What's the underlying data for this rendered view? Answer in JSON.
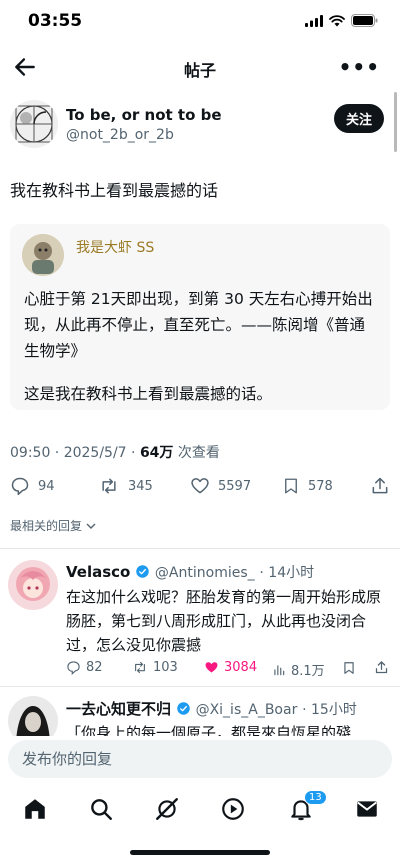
{
  "status_bar": {
    "time": "03:55"
  },
  "nav": {
    "title": "帖子"
  },
  "post": {
    "author_name": "To be, or not to be",
    "author_handle": "@not_2b_or_2b",
    "follow_label": "关注",
    "text": "我在教科书上看到最震撼的话",
    "quote": {
      "name": "我是大虾 SS",
      "body": "心脏于第 21天即出现，到第 30 天左右心搏开始出现，从此再不停止，直至死亡。——陈阅增《普通生物学》",
      "body2": "这是我在教科书上看到最震撼的话。"
    },
    "meta": {
      "time_date": "09:50 · 2025/5/7 · ",
      "views": "64万",
      "views_label": " 次查看"
    },
    "stats": {
      "replies": "94",
      "reposts": "345",
      "likes": "5597",
      "bookmarks": "578"
    }
  },
  "sort_label": "最相关的回复",
  "replies": [
    {
      "name": "Velasco",
      "handle": "@Antinomies_",
      "time": "· 14小时",
      "text": "在这加什么戏呢？胚胎发育的第一周开始形成原肠胚，第七到八周形成肛门，从此再也没闭合过，怎么没见你震撼",
      "replies": "82",
      "reposts": "103",
      "likes": "3084",
      "views": "8.1万"
    },
    {
      "name": "一去心知更不归",
      "handle": "@Xi_is_A_Boar",
      "time": "· 15小时",
      "text": "「你身上的每一個原子，都是來自恆星的殘"
    }
  ],
  "compose": {
    "placeholder": "发布你的回复"
  },
  "tabbar": {
    "notification_count": "13"
  },
  "colors": {
    "accent": "#1d9bf0",
    "like": "#f91880",
    "text": "#0f1419",
    "secondary": "#536471",
    "verified": "#1d9bf0"
  }
}
